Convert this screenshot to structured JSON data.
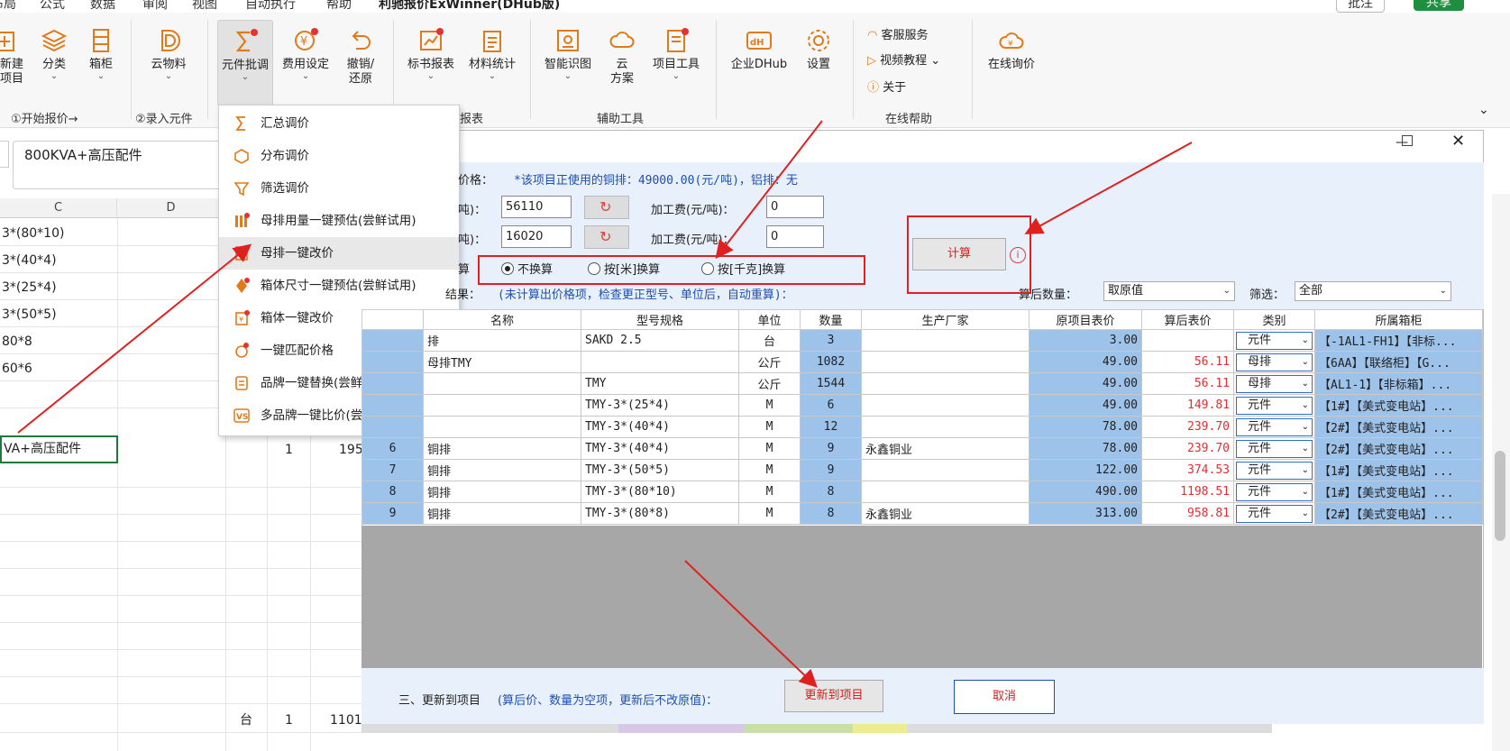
{
  "menubar": [
    "布局",
    "公式",
    "数据",
    "审阅",
    "视图",
    "自动执行",
    "帮助",
    "利驰报价ExWinner(DHub版)"
  ],
  "topright": {
    "comment": "批注",
    "share": "共享"
  },
  "ribbon": {
    "buttons": {
      "new_project": "新建\n项目",
      "category": "分类",
      "cabinet": "箱柜",
      "cloud_material": "云物料",
      "component_batch": "元件批调",
      "fee_settings": "费用设定",
      "undo_restore": "撤销/\n还原",
      "bid_report": "标书报表",
      "material_stats": "材料统计",
      "smart_recognize": "智能识图",
      "cloud_solution": "云\n方案",
      "project_tools": "项目工具",
      "enterprise_dhub": "企业DHub",
      "settings": "设置",
      "online_inquiry": "在线询价"
    },
    "help": {
      "customer_service": "客服服务",
      "video_tutorial": "视频教程",
      "about": "关于"
    },
    "groups": {
      "start_quote": "①开始报价→",
      "enter_component": "②录入元件",
      "report": "报表",
      "aux_tools": "辅助工具",
      "online_help": "在线帮助"
    }
  },
  "formula_bar": {
    "value": "800KVA+高压配件"
  },
  "sheet": {
    "col_c": "C",
    "col_d": "D",
    "cells": [
      "3*(80*10)",
      "3*(40*4)",
      "3*(25*4)",
      "3*(50*5)",
      "80*8",
      "60*6"
    ],
    "row_main": "VA+高压配件",
    "row_main_qty": "1",
    "row_main_val": "195",
    "bottom_unit": "台",
    "bottom_qty": "1",
    "bottom_val": "1101"
  },
  "dropdown": [
    {
      "label": "汇总调价",
      "icon": "sigma-icon"
    },
    {
      "label": "分布调价",
      "icon": "cube-icon"
    },
    {
      "label": "筛选调价",
      "icon": "funnel-icon"
    },
    {
      "label": "母排用量一键预估(尝鲜试用)",
      "icon": "busbar-estimate-icon"
    },
    {
      "label": "母排一键改价",
      "icon": "busbar-price-icon"
    },
    {
      "label": "箱体尺寸一键预估(尝鲜试用)",
      "icon": "box-size-icon"
    },
    {
      "label": "箱体一键改价",
      "icon": "box-price-icon"
    },
    {
      "label": "一键匹配价格",
      "icon": "match-price-icon"
    },
    {
      "label": "品牌一键替换(尝鲜试用)",
      "icon": "brand-replace-icon"
    },
    {
      "label": "多品牌一键比价(尝鲜试用)",
      "icon": "vs-icon"
    }
  ],
  "dialog": {
    "price_label": "价格：",
    "price_note": "*该项目正使用的铜排：49000.00(元/吨)，铝排：无",
    "row1_label": "吨)：",
    "row1_value": "56110",
    "row1_fee_label": "加工费(元/吨)：",
    "row1_fee": "0",
    "row2_label": "吨)：",
    "row2_value": "16020",
    "row2_fee_label": "加工费(元/吨)：",
    "row2_fee": "0",
    "convert_label": "算",
    "radio_none": "不换算",
    "radio_meter": "按[米]换算",
    "radio_kg": "按[千克]换算",
    "calc_button": "计算",
    "result_label": "结果：",
    "result_note": "(未计算出价格项，检查更正型号、单位后，自动重算)：",
    "qty_after_label": "算后数量：",
    "qty_after_value": "取原值",
    "filter_label": "筛选：",
    "filter_value": "全部",
    "headers": [
      "",
      "名称",
      "型号规格",
      "单位",
      "数量",
      "生产厂家",
      "原项目表价",
      "算后表价",
      "类别",
      "所属箱柜"
    ],
    "rows": [
      {
        "idx": "",
        "name": "排",
        "model": "SAKD 2.5",
        "unit": "台",
        "qty": "3",
        "maker": "",
        "orig": "3.00",
        "after": "",
        "type": "元件",
        "cabinet": "【-1AL1-FH1】【非标..."
      },
      {
        "idx": "",
        "name": "母排TMY",
        "model": "",
        "unit": "公斤",
        "qty": "1082",
        "maker": "",
        "orig": "49.00",
        "after": "56.11",
        "type": "母排",
        "cabinet": "【6AA】【联络柜】【G..."
      },
      {
        "idx": "",
        "name": "",
        "model": "TMY",
        "unit": "公斤",
        "qty": "1544",
        "maker": "",
        "orig": "49.00",
        "after": "56.11",
        "type": "母排",
        "cabinet": "【AL1-1】【非标箱】..."
      },
      {
        "idx": "",
        "name": "",
        "model": "TMY-3*(25*4)",
        "unit": "M",
        "qty": "6",
        "maker": "",
        "orig": "49.00",
        "after": "149.81",
        "type": "元件",
        "cabinet": "【1#】【美式变电站】..."
      },
      {
        "idx": "",
        "name": "",
        "model": "TMY-3*(40*4)",
        "unit": "M",
        "qty": "12",
        "maker": "",
        "orig": "78.00",
        "after": "239.70",
        "type": "元件",
        "cabinet": "【2#】【美式变电站】..."
      },
      {
        "idx": "6",
        "name": "铜排",
        "model": "TMY-3*(40*4)",
        "unit": "M",
        "qty": "9",
        "maker": "永鑫铜业",
        "orig": "78.00",
        "after": "239.70",
        "type": "元件",
        "cabinet": "【2#】【美式变电站】..."
      },
      {
        "idx": "7",
        "name": "铜排",
        "model": "TMY-3*(50*5)",
        "unit": "M",
        "qty": "9",
        "maker": "",
        "orig": "122.00",
        "after": "374.53",
        "type": "元件",
        "cabinet": "【1#】【美式变电站】..."
      },
      {
        "idx": "8",
        "name": "铜排",
        "model": "TMY-3*(80*10)",
        "unit": "M",
        "qty": "8",
        "maker": "",
        "orig": "490.00",
        "after": "1198.51",
        "type": "元件",
        "cabinet": "【1#】【美式变电站】..."
      },
      {
        "idx": "9",
        "name": "铜排",
        "model": "TMY-3*(80*8)",
        "unit": "M",
        "qty": "8",
        "maker": "永鑫铜业",
        "orig": "313.00",
        "after": "958.81",
        "type": "元件",
        "cabinet": "【2#】【美式变电站】..."
      }
    ],
    "update_label": "三、更新到项目",
    "update_note": "(算后价、数量为空项，更新后不改原值)：",
    "update_button": "更新到项目",
    "cancel_button": "取消"
  },
  "colors": {
    "accent_red": "#e02020",
    "row_blue": "#9ec3ea",
    "dialog_bg": "#e7f0fb",
    "table_gray": "#a7a7a7"
  }
}
